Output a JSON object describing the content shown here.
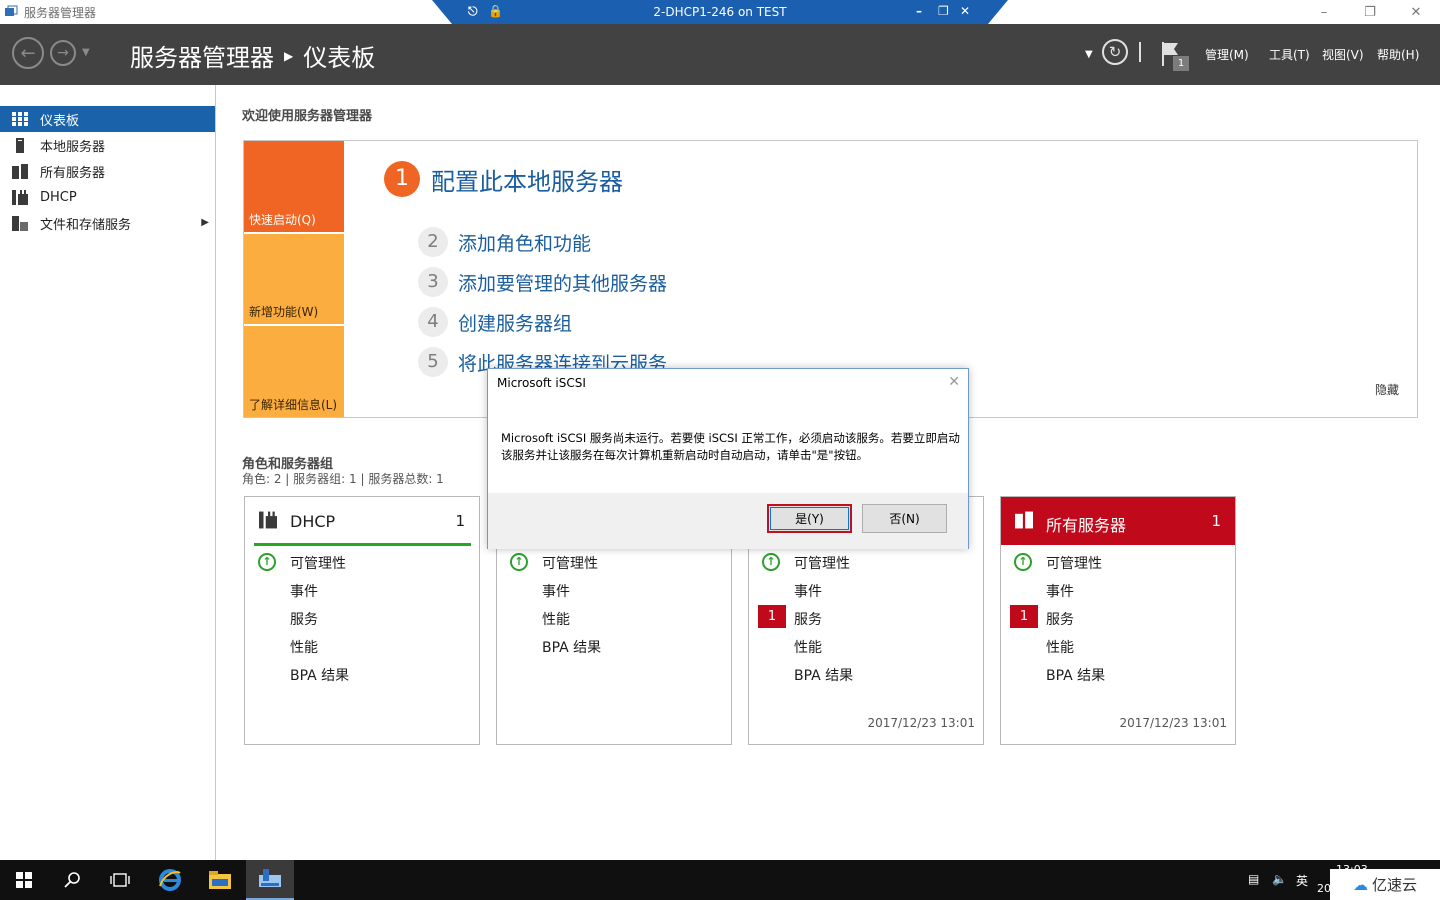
{
  "window": {
    "app_title": "服务器管理器",
    "controls": [
      "minimize-icon",
      "restore-icon",
      "close-icon"
    ]
  },
  "rdp_bar": {
    "title": "2-DHCP1-246 on TEST",
    "icons": [
      "pin-icon",
      "lock-icon",
      "minimize-icon",
      "restore-icon",
      "close-icon"
    ]
  },
  "header": {
    "app_name": "服务器管理器",
    "page": "仪表板",
    "menu": {
      "manage": "管理(M)",
      "tools": "工具(T)",
      "view": "视图(V)",
      "help": "帮助(H)"
    },
    "notification_count": "1"
  },
  "sidebar": {
    "items": [
      {
        "label": "仪表板",
        "icon": "dashboard-icon",
        "active": true
      },
      {
        "label": "本地服务器",
        "icon": "server-icon"
      },
      {
        "label": "所有服务器",
        "icon": "servers-icon"
      },
      {
        "label": "DHCP",
        "icon": "dhcp-icon"
      },
      {
        "label": "文件和存储服务",
        "icon": "storage-icon"
      }
    ]
  },
  "main": {
    "welcome": "欢迎使用服务器管理器",
    "quick_start": {
      "tiles": [
        "快速启动(Q)",
        "新增功能(W)",
        "了解详细信息(L)"
      ],
      "steps": [
        {
          "num": "1",
          "label": "配置此本地服务器"
        },
        {
          "num": "2",
          "label": "添加角色和功能"
        },
        {
          "num": "3",
          "label": "添加要管理的其他服务器"
        },
        {
          "num": "4",
          "label": "创建服务器组"
        },
        {
          "num": "5",
          "label": "将此服务器连接到云服务"
        }
      ],
      "hide": "隐藏"
    },
    "roles_title": "角色和服务器组",
    "roles_summary": "角色: 2 | 服务器组: 1 | 服务器总数: 1",
    "cards": [
      {
        "name": "DHCP",
        "count": "1",
        "rows": [
          "可管理性",
          "事件",
          "服务",
          "性能",
          "BPA 结果"
        ]
      },
      {
        "rows": [
          "可管理性",
          "事件",
          "性能",
          "BPA 结果"
        ]
      },
      {
        "rows": [
          "可管理性",
          "事件",
          "服务",
          "性能",
          "BPA 结果"
        ],
        "service_badge": "1",
        "timestamp": "2017/12/23 13:01"
      },
      {
        "name": "所有服务器",
        "count": "1",
        "rows": [
          "可管理性",
          "事件",
          "服务",
          "性能",
          "BPA 结果"
        ],
        "service_badge": "1",
        "timestamp": "2017/12/23 13:01"
      }
    ]
  },
  "dialog": {
    "title": "Microsoft iSCSI",
    "message": "Microsoft iSCSI 服务尚未运行。若要使 iSCSI 正常工作，必须启动该服务。若要立即启动该服务并让该服务在每次计算机重新启动时自动启动，请单击\"是\"按钮。",
    "yes": "是(Y)",
    "no": "否(N)"
  },
  "taskbar": {
    "time": "13:03",
    "date_partial": "20",
    "ime": "英",
    "watermark": "亿速云"
  },
  "colors": {
    "header_bg": "#424242",
    "active_blue": "#1a63aa",
    "orange_primary": "#f06523",
    "orange_secondary": "#fbad40",
    "alert_red": "#c0091a",
    "ok_green": "#2c9f2c",
    "link_blue": "#1b5e9f"
  }
}
